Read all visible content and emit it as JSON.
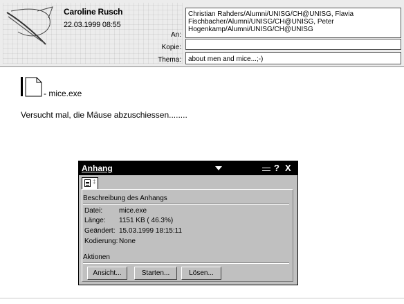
{
  "header": {
    "sender": "Caroline Rusch",
    "date": "22.03.1999 08:55",
    "labels": {
      "to": "An:",
      "cc": "Kopie:",
      "subject": "Thema:"
    },
    "to_value": "Christian Rahders/Alumni/UNISG/CH@UNISG, Flavia Fischbacher/Alumni/UNISG/CH@UNISG, Peter Hogenkamp/Alumni/UNISG/CH@UNISG",
    "cc_value": "",
    "subject_value": "about men and mice...;-)"
  },
  "body": {
    "attachment_label": "- mice.exe",
    "message": "Versucht mal, die Mäuse abzuschiessen........"
  },
  "attachment_window": {
    "title": "Anhang",
    "tab_glyph": "‡",
    "icons": {
      "dropdown": "chevron-down-icon",
      "pin": "pin-icon",
      "help": "help-icon",
      "close": "close-icon",
      "tab": "document-icon"
    },
    "help_glyph": "?",
    "close_glyph": "X",
    "description_heading": "Beschreibung des Anhangs",
    "rows": [
      {
        "key": "Datei:",
        "value": "mice.exe"
      },
      {
        "key": "Länge:",
        "value": "1151 KB ( 46.3%)"
      },
      {
        "key": "Geändert:",
        "value": "15.03.1999 18:15:11"
      },
      {
        "key": "Kodierung:",
        "value": "None"
      }
    ],
    "actions_heading": "Aktionen",
    "buttons": {
      "view": "Ansicht...",
      "start": "Starten...",
      "detach": "Lösen..."
    }
  }
}
